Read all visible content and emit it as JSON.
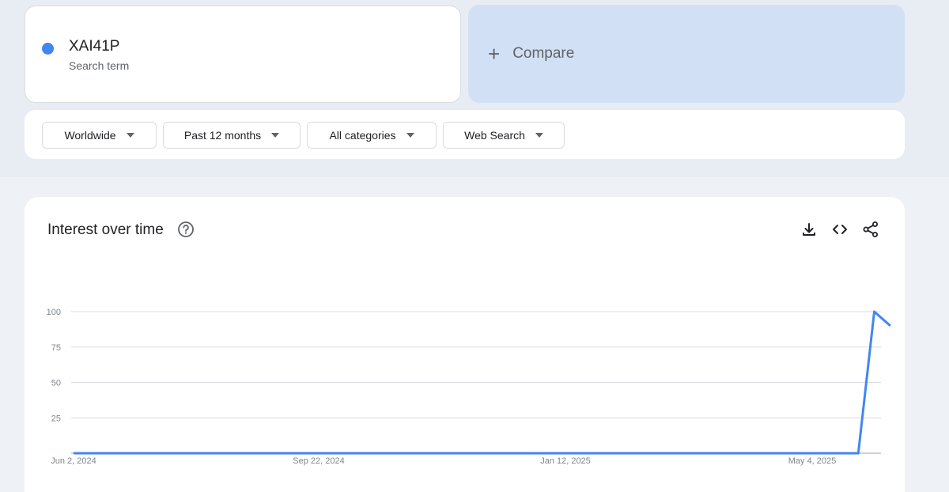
{
  "search_term": {
    "name": "XAI41P",
    "subtitle": "Search term",
    "color": "#4285f4"
  },
  "compare": {
    "label": "Compare",
    "icon": "plus-icon"
  },
  "filters": [
    {
      "label": "Worldwide"
    },
    {
      "label": "Past 12 months"
    },
    {
      "label": "All categories"
    },
    {
      "label": "Web Search"
    }
  ],
  "panel": {
    "title": "Interest over time",
    "help_icon": "help-circle-icon",
    "tools": [
      "download-icon",
      "embed-code-icon",
      "share-icon"
    ]
  },
  "chart_data": {
    "type": "line",
    "x_tick_labels": [
      "Jun 2, 2024",
      "Sep 22, 2024",
      "Jan 12, 2025",
      "May 4, 2025"
    ],
    "y_ticks": [
      25,
      50,
      75,
      100
    ],
    "ylim": [
      0,
      100
    ],
    "x": [
      "2024-06-02",
      "2025-05-04",
      "2025-05-11",
      "2025-05-18",
      "2025-05-25"
    ],
    "series": [
      {
        "values": [
          0,
          0,
          0,
          100,
          90
        ],
        "color": "#4285f4"
      }
    ],
    "grid": true
  }
}
